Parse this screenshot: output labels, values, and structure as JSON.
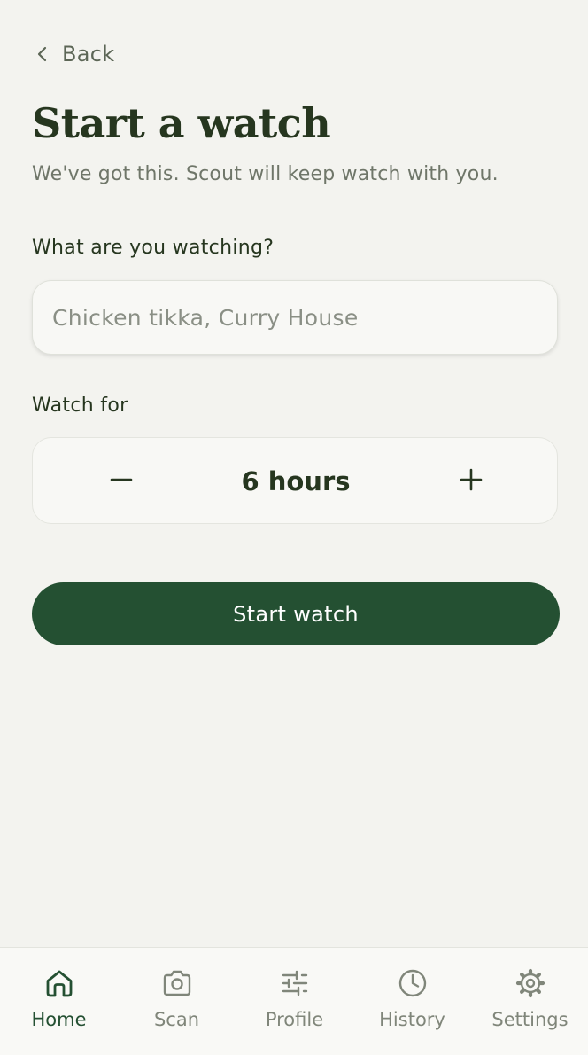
{
  "nav": {
    "back_label": "Back"
  },
  "page": {
    "title": "Start a watch",
    "subtitle": "We've got this. Scout will keep watch with you."
  },
  "form": {
    "what_label": "What are you watching?",
    "what_value": "",
    "what_placeholder": "Chicken tikka, Curry House",
    "duration_label": "Watch for",
    "duration_value": "6 hours",
    "submit_label": "Start watch"
  },
  "tabbar": {
    "items": [
      {
        "label": "Home",
        "icon": "home-icon",
        "active": true
      },
      {
        "label": "Scan",
        "icon": "camera-icon",
        "active": false
      },
      {
        "label": "Profile",
        "icon": "sliders-icon",
        "active": false
      },
      {
        "label": "History",
        "icon": "clock-icon",
        "active": false
      },
      {
        "label": "Settings",
        "icon": "gear-icon",
        "active": false
      }
    ]
  },
  "colors": {
    "background": "#f3f3ef",
    "primary": "#245032",
    "heading": "#26361f",
    "muted": "#80867a"
  }
}
